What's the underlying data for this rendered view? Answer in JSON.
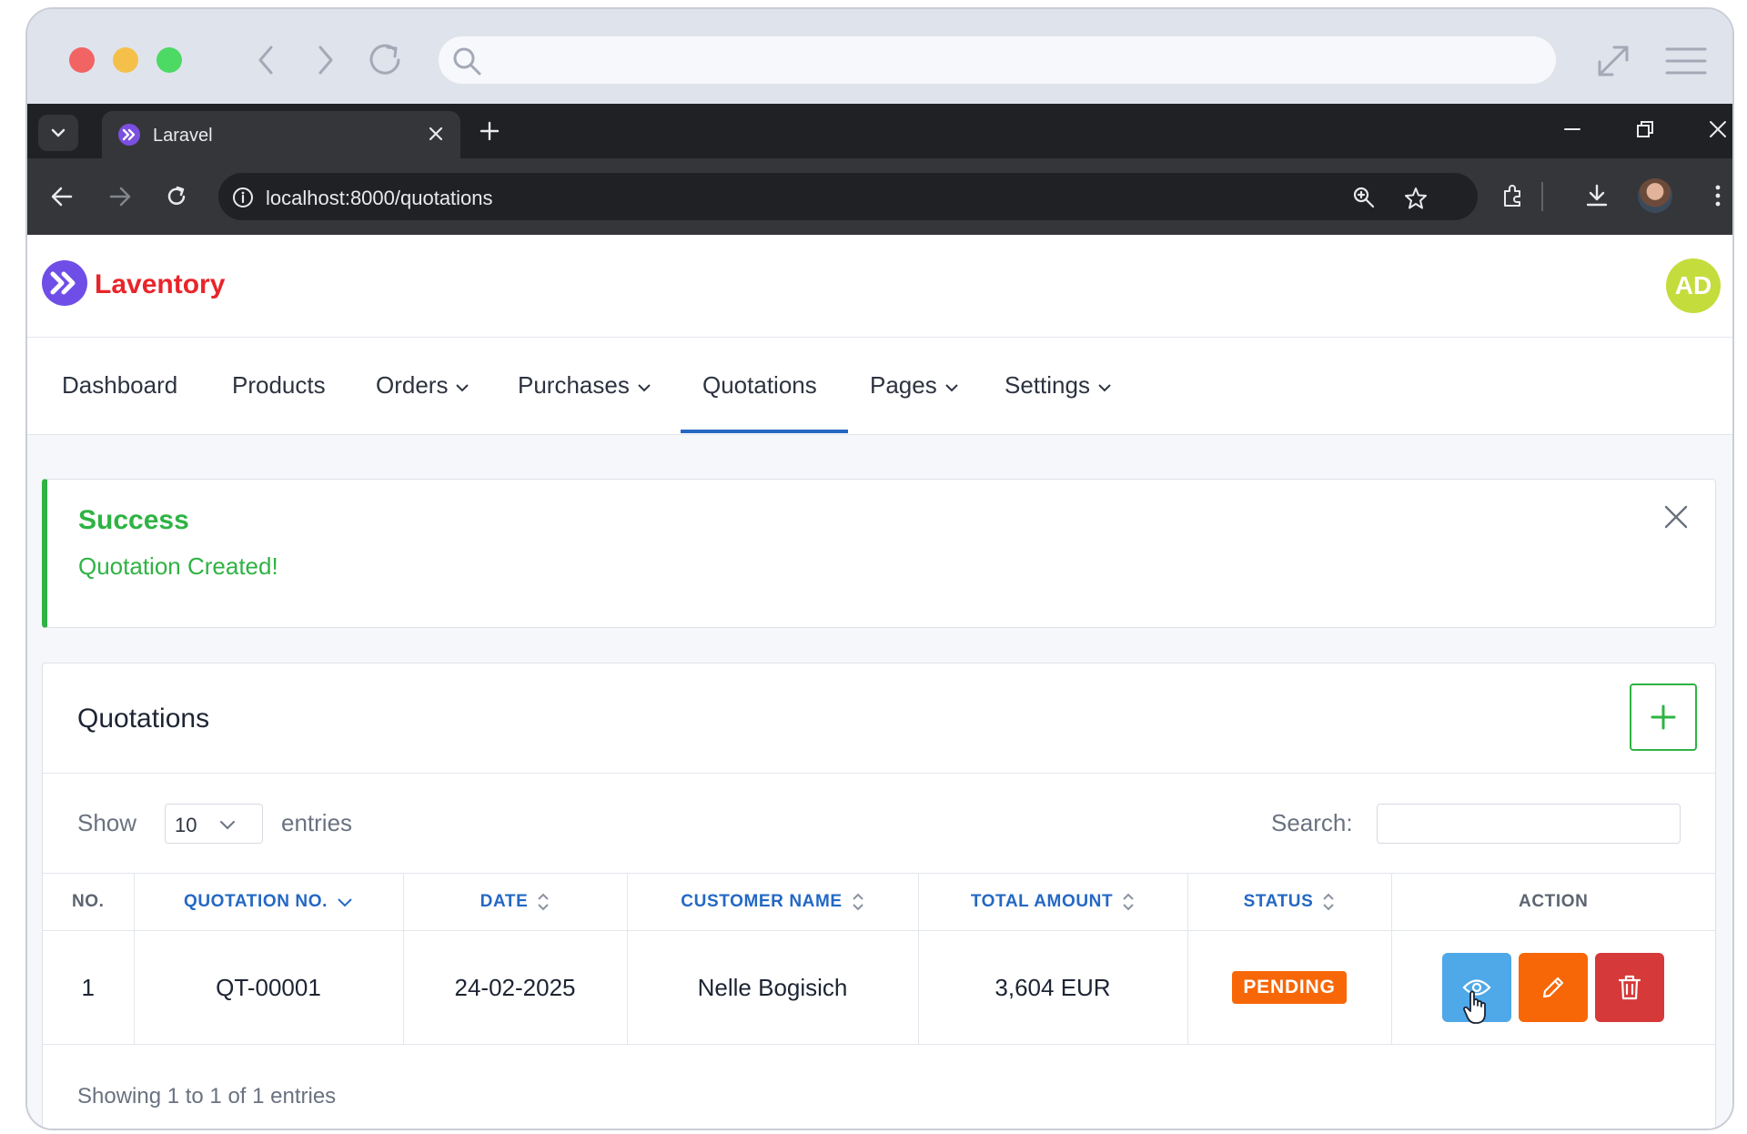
{
  "browser": {
    "tab_title": "Laravel",
    "url": "localhost:8000/quotations"
  },
  "app": {
    "brand_name": "Laventory",
    "avatar_initials": "AD"
  },
  "nav": {
    "items": [
      {
        "label": "Dashboard",
        "dropdown": false,
        "active": false
      },
      {
        "label": "Products",
        "dropdown": false,
        "active": false
      },
      {
        "label": "Orders",
        "dropdown": true,
        "active": false
      },
      {
        "label": "Purchases",
        "dropdown": true,
        "active": false
      },
      {
        "label": "Quotations",
        "dropdown": false,
        "active": true
      },
      {
        "label": "Pages",
        "dropdown": true,
        "active": false
      },
      {
        "label": "Settings",
        "dropdown": true,
        "active": false
      }
    ]
  },
  "alert": {
    "title": "Success",
    "message": "Quotation Created!",
    "color": "#2fb344"
  },
  "card": {
    "title": "Quotations",
    "show_label": "Show",
    "entries_value": "10",
    "entries_label": "entries",
    "search_label": "Search:",
    "search_value": ""
  },
  "table": {
    "columns": [
      "NO.",
      "QUOTATION NO.",
      "DATE",
      "CUSTOMER NAME",
      "TOTAL AMOUNT",
      "STATUS",
      "ACTION"
    ],
    "rows": [
      {
        "no": "1",
        "quotation_no": "QT-00001",
        "date": "24-02-2025",
        "customer": "Nelle Bogisich",
        "total": "3,604 EUR",
        "status": "PENDING"
      }
    ],
    "footer": "Showing 1 to 1 of 1 entries"
  },
  "colors": {
    "brand": "#e8252a",
    "accent": "#2468c4",
    "status_pending": "#f76707",
    "view_button": "#4fa8e8",
    "edit_button": "#f76707",
    "delete_button": "#d63939"
  }
}
